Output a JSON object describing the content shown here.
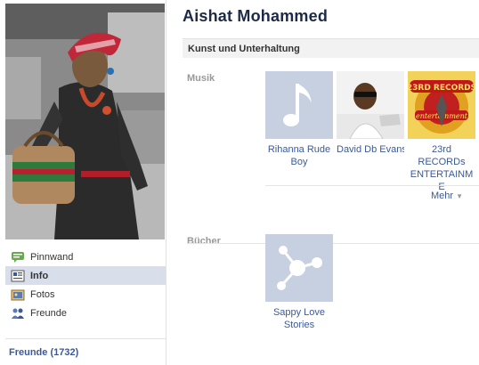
{
  "profile": {
    "name": "Aishat Mohammed",
    "friends_label": "Freunde (1732)"
  },
  "nav": {
    "items": [
      {
        "label": "Pinnwand",
        "icon": "wall-icon"
      },
      {
        "label": "Info",
        "icon": "info-icon",
        "active": true
      },
      {
        "label": "Fotos",
        "icon": "photos-icon"
      },
      {
        "label": "Freunde",
        "icon": "friends-icon"
      }
    ]
  },
  "section": {
    "title": "Kunst und Unterhaltung"
  },
  "music": {
    "label": "Musik",
    "items": [
      {
        "name": "Rihanna Rude Boy",
        "icon": "music-note-icon"
      },
      {
        "name": "David Db Evans",
        "icon": "person-photo"
      },
      {
        "name": "23rd RECORDs ENTERTAINME",
        "icon": "record-logo"
      }
    ],
    "more_label": "Mehr"
  },
  "books": {
    "label": "Bücher",
    "items": [
      {
        "name": "Sappy Love Stories",
        "icon": "share-network-icon"
      }
    ]
  },
  "colors": {
    "link": "#3b5998",
    "name": "#1c2a47",
    "nav_active_bg": "#d8dfea",
    "placeholder_tile": "#c6d0e0"
  }
}
